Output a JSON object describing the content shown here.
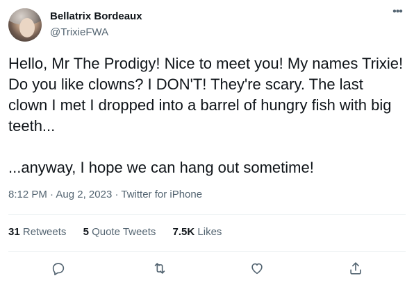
{
  "author": {
    "name": "Bellatrix Bordeaux",
    "handle": "@TrixieFWA"
  },
  "tweet": {
    "text": "Hello, Mr The Prodigy! Nice to meet you! My names Trixie! Do you like clowns? I DON'T! They're scary. The last clown I met I dropped into a barrel of hungry fish with big teeth...\n\n...anyway, I hope we can hang out sometime!",
    "time": "8:12 PM",
    "date": "Aug 2, 2023",
    "source": "Twitter for iPhone",
    "sep": " · "
  },
  "stats": {
    "retweets_count": "31",
    "retweets_label": "Retweets",
    "quotes_count": "5",
    "quotes_label": "Quote Tweets",
    "likes_count": "7.5K",
    "likes_label": "Likes"
  },
  "more_glyph": "•••",
  "icons": {
    "reply": "reply-icon",
    "retweet": "retweet-icon",
    "like": "heart-icon",
    "share": "share-icon",
    "more": "more-icon"
  }
}
